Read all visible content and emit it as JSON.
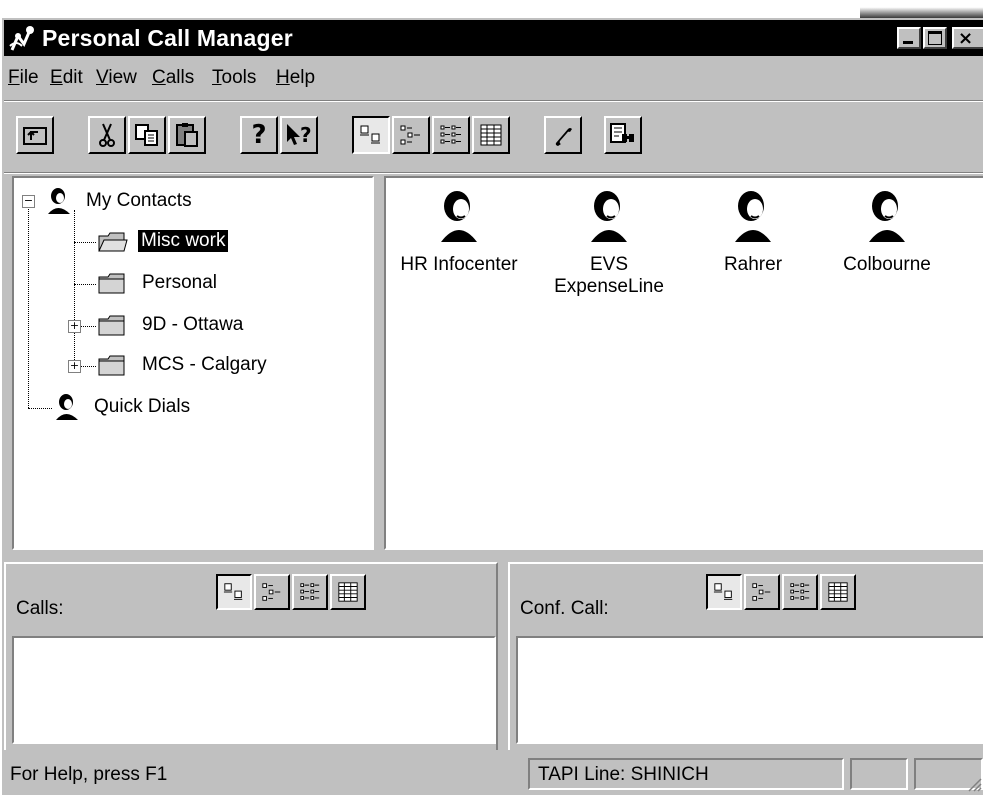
{
  "window": {
    "title": "Personal Call Manager",
    "controls": [
      "minimize-icon",
      "maximize-icon",
      "close-icon"
    ]
  },
  "menubar": {
    "items": [
      "File",
      "Edit",
      "View",
      "Calls",
      "Tools",
      "Help"
    ]
  },
  "toolbar": {
    "buttons": [
      "up-folder-icon",
      "cut-icon",
      "copy-icon",
      "paste-icon",
      "help-icon",
      "context-help-icon",
      "large-icons-view-icon",
      "small-icons-view-icon",
      "list-view-icon",
      "details-view-icon",
      "dial-phone-icon",
      "find-contact-icon"
    ],
    "pressed": "large-icons-view-icon"
  },
  "tree": {
    "root": "My Contacts",
    "items": [
      "Misc work",
      "Personal",
      "9D - Ottawa",
      "MCS - Calgary"
    ],
    "selected": "Misc work",
    "quick_dials": "Quick Dials"
  },
  "contacts": [
    {
      "name": "HR Infocenter"
    },
    {
      "name": "EVS",
      "name2": "ExpenseLine"
    },
    {
      "name": "Rahrer"
    },
    {
      "name": "Colbourne"
    }
  ],
  "calls_panel": {
    "label": "Calls:"
  },
  "conf_panel": {
    "label": "Conf. Call:"
  },
  "statusbar": {
    "help_text": "For Help, press F1",
    "tapi_line": "TAPI Line: SHINICH"
  }
}
